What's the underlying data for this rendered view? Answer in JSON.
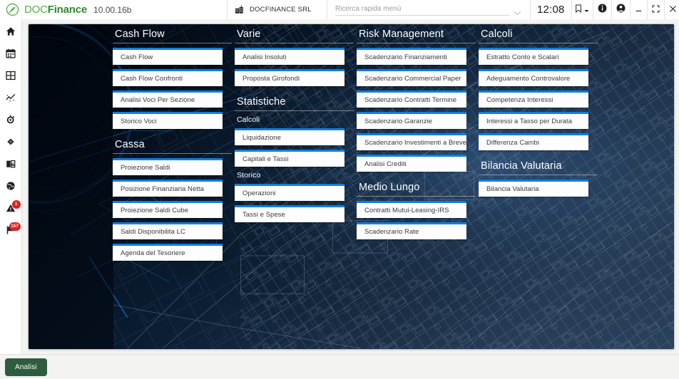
{
  "topbar": {
    "logo_doc": "DOC",
    "logo_fin": "Finance",
    "version": "10.00.16b",
    "company": "DOCFINANCE SRL",
    "search_placeholder": "Ricerca rapida menù",
    "search_value": "",
    "clock": "12:08",
    "icons": {
      "logo": "docfinance-logo-icon",
      "company": "building-icon",
      "search_chevron": "chevron-down-icon",
      "bookmark": "bookmark-icon",
      "bookmark_caret": "caret-down-icon",
      "info": "info-icon",
      "account": "user-account-icon",
      "minimize": "minimize-icon",
      "maximize": "maximize-icon",
      "close": "close-icon"
    },
    "accent_green": "#53b04f"
  },
  "sidebar": {
    "items": [
      {
        "name": "home",
        "icon": "home-icon",
        "badge": ""
      },
      {
        "name": "calendar",
        "icon": "calendar-icon",
        "badge": ""
      },
      {
        "name": "grid",
        "icon": "grid-table-icon",
        "badge": ""
      },
      {
        "name": "analytics",
        "icon": "line-chart-icon",
        "badge": ""
      },
      {
        "name": "settings",
        "icon": "gear-icon",
        "badge": ""
      },
      {
        "name": "tag",
        "icon": "diamond-tag-icon",
        "badge": ""
      },
      {
        "name": "reports",
        "icon": "open-book-icon",
        "badge": ""
      },
      {
        "name": "world",
        "icon": "globe-icon",
        "badge": ""
      },
      {
        "name": "alerts",
        "icon": "warning-triangle-icon",
        "badge": "1"
      },
      {
        "name": "flags",
        "icon": "flag-icon",
        "badge": "157"
      }
    ],
    "badge_color": "#e02020"
  },
  "menu": {
    "card_accent": "#0f7fe0",
    "columns": [
      {
        "groups": [
          {
            "title": "Cash Flow",
            "items": [
              {
                "label": "Cash Flow"
              },
              {
                "label": "Cash Flow Confronti"
              },
              {
                "label": "Analisi Voci Per Sezione"
              },
              {
                "label": "Storico Voci"
              }
            ]
          },
          {
            "title": "Cassa",
            "items": [
              {
                "label": "Proiezione Saldi"
              },
              {
                "label": "Posizione Finanziaria Netta"
              },
              {
                "label": "Proiezione Saldi Cube"
              },
              {
                "label": "Saldi Disponibilita LC"
              },
              {
                "label": "Agenda del Tesoriere"
              }
            ]
          }
        ]
      },
      {
        "groups": [
          {
            "title": "Varie",
            "items": [
              {
                "label": "Analisi Insoluti"
              },
              {
                "label": "Proposta Girofondi"
              }
            ]
          },
          {
            "title": "Statistiche",
            "subgroups": [
              {
                "subtitle": "Calcoli",
                "items": [
                  {
                    "label": "Liquidazione"
                  },
                  {
                    "label": "Capitali e Tassi"
                  }
                ]
              },
              {
                "subtitle": "Storico",
                "items": [
                  {
                    "label": "Operazioni"
                  },
                  {
                    "label": "Tassi e Spese"
                  }
                ]
              }
            ]
          }
        ]
      },
      {
        "groups": [
          {
            "title": "Risk Management",
            "items": [
              {
                "label": "Scadenzario Finanziamenti"
              },
              {
                "label": "Scadenzario Commercial Paper"
              },
              {
                "label": "Scadenzario Contratti Termine"
              },
              {
                "label": "Scadenzario Garanzie"
              },
              {
                "label": "Scadenzario Investimenti a Breve"
              },
              {
                "label": "Analisi Crediti"
              }
            ]
          },
          {
            "title": "Medio Lungo",
            "items": [
              {
                "label": "Contratti Mutui-Leasing-IRS"
              },
              {
                "label": "Scadenzario Rate"
              }
            ]
          }
        ]
      },
      {
        "groups": [
          {
            "title": "Calcoli",
            "items": [
              {
                "label": "Estratto Conto e Scalari"
              },
              {
                "label": "Adeguamento Controvalore"
              },
              {
                "label": "Competenza Interessi"
              },
              {
                "label": "Interessi a Tasso per Durata"
              },
              {
                "label": "Differenza Cambi"
              }
            ]
          },
          {
            "title": "Bilancia Valutaria",
            "items": [
              {
                "label": "Bilancia Valutaria"
              }
            ]
          }
        ]
      }
    ]
  },
  "taskbar": {
    "buttons": [
      {
        "label": "Analisi",
        "color": "#2f5c3f"
      }
    ]
  }
}
